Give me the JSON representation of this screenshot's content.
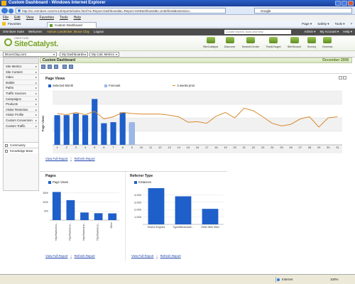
{
  "window": {
    "title": "Custom Dashboard - Windows Internet Explorer"
  },
  "browser": {
    "url": "http://sc.omniture.com/sc14/reports/index.html?a=Report.Dashboard&r=Report.GetDashboard&r=undefined&ssession=",
    "search_engine": "Google",
    "menu": [
      "File",
      "Edit",
      "View",
      "Favorites",
      "Tools",
      "Help"
    ],
    "favorites_label": "Favorites",
    "tab_title": "Custom Dashboard",
    "tools": [
      "Page ▾",
      "Safety ▾",
      "Tools ▾",
      "?"
    ]
  },
  "omniture_bar": {
    "product": "Omniture Suite",
    "welcome": "Welcome:",
    "user": "Aarron Landecker, Bruce Clay",
    "logout": "Logout",
    "search_placeholder": "Locate reports, tools and help",
    "right": [
      "Admin ▾",
      "My Account ▾",
      "Help ▾"
    ]
  },
  "brand": {
    "company": "OMNITURE",
    "product": "SiteCatalyst."
  },
  "toolbar": [
    "SiteCatalyst",
    "Discover",
    "SearchCenter",
    "Test&Target",
    "SiteSearch",
    "Survey",
    "Genesis"
  ],
  "selectors": {
    "site": "BruceClay.com",
    "dashboard": "My Dashboards",
    "metrics": "My Calc Metrics"
  },
  "sidebar": {
    "items": [
      "Site Metrics",
      "Site Content",
      "Video",
      "Mobile",
      "Paths",
      "Traffic Sources",
      "Campaigns",
      "Products",
      "Visitor Retention",
      "Visitor Profile",
      "Custom Conversion",
      "Custom Traffic"
    ],
    "footer": [
      "Community",
      "Knowledge Base"
    ]
  },
  "dashboard": {
    "title": "Custom Dashboard",
    "date": "December 2008"
  },
  "links": {
    "full": "View Full Report",
    "sep": "|",
    "refresh": "Refresh Report"
  },
  "colors": {
    "bar": "#1f5fc9",
    "forecast": "#9bb7e6",
    "line": "#d98a2b",
    "accent": "#7aa52b"
  },
  "chart_data": [
    {
      "type": "bar",
      "title": "Page Views",
      "ylabel": "Page Views",
      "legend": [
        "Selected Month",
        "Forecast",
        "4 weeks prior"
      ],
      "categories": [
        "1",
        "2",
        "3",
        "4",
        "5",
        "6",
        "7",
        "8",
        "9",
        "10",
        "11",
        "12",
        "13",
        "14",
        "15",
        "16",
        "17",
        "18",
        "19",
        "20",
        "21",
        "22",
        "23",
        "24",
        "25",
        "26",
        "27",
        "28",
        "29",
        "30",
        "31"
      ],
      "x_caption": "Dec 2008",
      "ylim": [
        0,
        100
      ],
      "series": [
        {
          "name": "Selected Month",
          "values": [
            55,
            55,
            58,
            55,
            85,
            40,
            42,
            60,
            38,
            null,
            null,
            null,
            null,
            null,
            null,
            null,
            null,
            null,
            null,
            null,
            null,
            null,
            null,
            null,
            null,
            null,
            null,
            null,
            null,
            null,
            null
          ]
        },
        {
          "name": "Forecast",
          "values": [
            null,
            null,
            null,
            null,
            null,
            null,
            null,
            null,
            42,
            null,
            null,
            null,
            null,
            null,
            null,
            null,
            null,
            null,
            null,
            null,
            null,
            null,
            null,
            null,
            null,
            null,
            null,
            null,
            null,
            null,
            null
          ]
        },
        {
          "name": "4 weeks prior",
          "values": [
            58,
            56,
            60,
            56,
            62,
            48,
            52,
            60,
            58,
            57,
            57,
            57,
            55,
            52,
            42,
            43,
            40,
            53,
            60,
            50,
            68,
            63,
            52,
            40,
            35,
            38,
            48,
            52,
            33,
            50,
            52
          ]
        }
      ]
    },
    {
      "type": "bar",
      "title": "Pages",
      "legend": [
        "Page Views"
      ],
      "yticks": [
        "15%",
        "10%",
        "5%"
      ],
      "ylim": [
        0,
        18
      ],
      "categories": [
        "http://www.bruc...",
        "http://www.bruc...",
        "http://www.bruc...",
        "http://www.bruc...",
        "Other"
      ],
      "values": [
        15.5,
        11.0,
        4.2,
        3.8,
        3.7
      ]
    },
    {
      "type": "bar",
      "title": "Referrer Type",
      "legend": [
        "Instances"
      ],
      "yticks": [
        "4,000",
        "3,000",
        "2,000",
        "1,000"
      ],
      "ylim": [
        0,
        5000
      ],
      "categories": [
        "Search Engines",
        "Typed/Bookmark...",
        "Other Web Sites"
      ],
      "values": [
        4900,
        3800,
        2100
      ]
    }
  ],
  "status": {
    "zone": "Internet",
    "zoom": "100%"
  }
}
